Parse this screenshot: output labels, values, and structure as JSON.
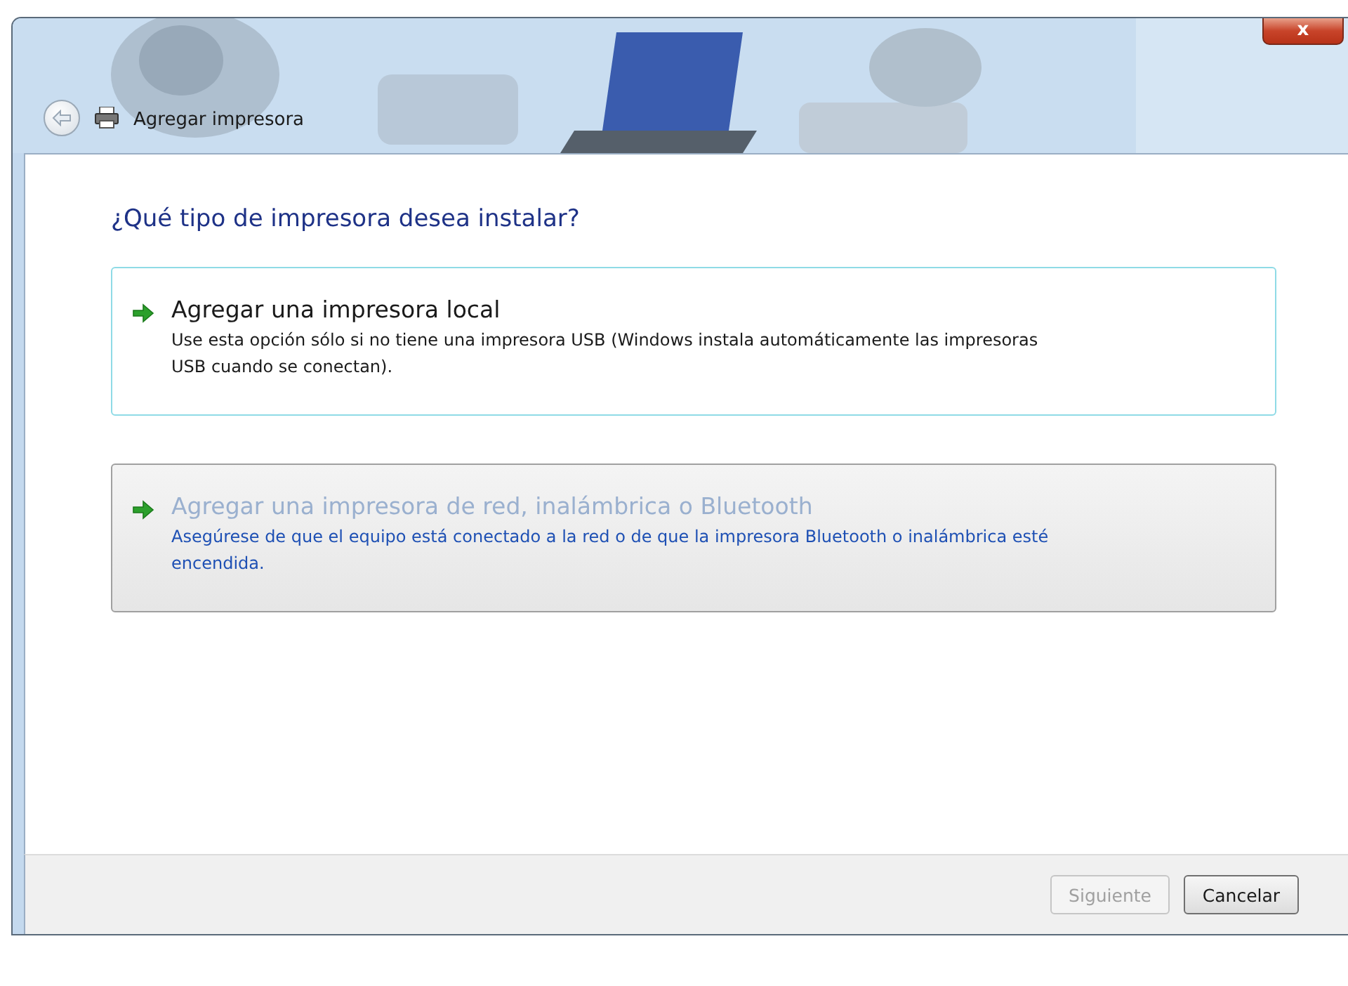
{
  "window": {
    "title": "Agregar impresora",
    "close_label": "x"
  },
  "heading": "¿Qué tipo de impresora desea instalar?",
  "options": [
    {
      "title": "Agregar una impresora local",
      "description": "Use esta opción sólo si no tiene una impresora USB (Windows instala automáticamente las impresoras USB cuando se conectan).",
      "hovered": true,
      "focused": false
    },
    {
      "title": "Agregar una impresora de red, inalámbrica o Bluetooth",
      "description": "Asegúrese de que el equipo está conectado a la red o de que la impresora Bluetooth o inalámbrica esté encendida.",
      "hovered": false,
      "focused": true
    }
  ],
  "buttons": [
    {
      "label": "Siguiente",
      "disabled": true
    },
    {
      "label": "Cancelar",
      "disabled": false
    }
  ]
}
